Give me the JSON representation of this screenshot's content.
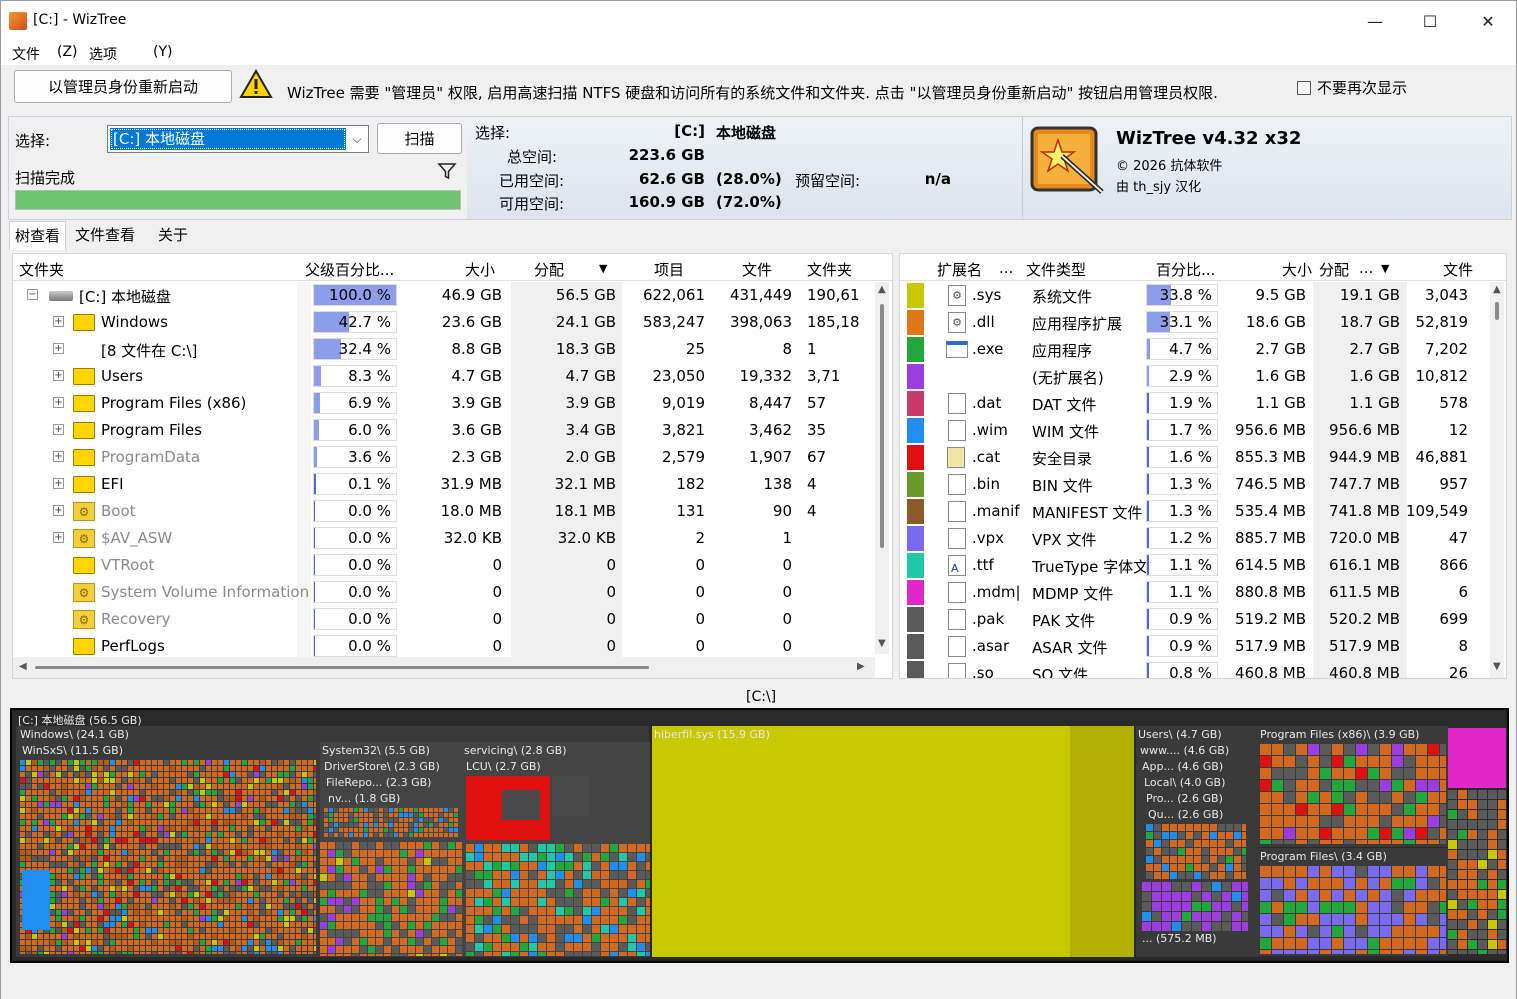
{
  "window": {
    "title": "[C:]  - WizTree",
    "minimize": "—",
    "maximize": "☐",
    "close": "✕"
  },
  "menu": [
    "文件",
    "(Z)",
    "选项",
    "(Y)"
  ],
  "admin": {
    "button": "以管理员身份重新启动",
    "message": "WizTree 需要 \"管理员\" 权限, 启用高速扫描 NTFS 硬盘和访问所有的系统文件和文件夹. 点击 \"以管理员身份重新启动\" 按钮启用管理员权限.",
    "dont_show": "不要再次显示"
  },
  "select": {
    "label": "选择:",
    "value": "[C:] 本地磁盘",
    "scan_button": "扫描",
    "status": "扫描完成",
    "progress": 1.0
  },
  "info": {
    "select_label": "选择:",
    "drive": "[C:]",
    "drive_name": "本地磁盘",
    "total_label": "总空间:",
    "total": "223.6 GB",
    "used_label": "已用空间:",
    "used": "62.6 GB",
    "used_pct": "(28.0%)",
    "free_label": "可用空间:",
    "free": "160.9 GB",
    "free_pct": "(72.0%)",
    "reserved_label": "预留空间:",
    "reserved": "n/a"
  },
  "brand": {
    "name": "WizTree v4.32 x32",
    "copyright": "© 2026 抗体软件",
    "credit": "由 th_sjy 汉化"
  },
  "tabs": [
    "树查看",
    "文件查看",
    "关于"
  ],
  "tree": {
    "columns": [
      "文件夹",
      "父级百分比...",
      "大小",
      "分配",
      "项目",
      "文件",
      "文件夹"
    ],
    "rows": [
      {
        "name": "[C:] 本地磁盘",
        "pct": "100.0 %",
        "pctv": 1.0,
        "size": "46.9 GB",
        "alloc": "56.5 GB",
        "items": "622,061",
        "files": "431,449",
        "folders": "190,61",
        "icon": "drive",
        "exp": "−",
        "gray": false
      },
      {
        "name": "Windows",
        "pct": "42.7 %",
        "pctv": 0.427,
        "size": "23.6 GB",
        "alloc": "24.1 GB",
        "items": "583,247",
        "files": "398,063",
        "folders": "185,18",
        "icon": "folder",
        "exp": "+",
        "gray": false
      },
      {
        "name": "[8 文件在       C:\\]",
        "pct": "32.4 %",
        "pctv": 0.324,
        "size": "8.8 GB",
        "alloc": "18.3 GB",
        "items": "25",
        "files": "8",
        "folders": "1",
        "icon": "none",
        "exp": "+",
        "gray": false
      },
      {
        "name": "Users",
        "pct": "8.3 %",
        "pctv": 0.083,
        "size": "4.7 GB",
        "alloc": "4.7 GB",
        "items": "23,050",
        "files": "19,332",
        "folders": "3,71",
        "icon": "folder",
        "exp": "+",
        "gray": false
      },
      {
        "name": "Program Files (x86)",
        "pct": "6.9 %",
        "pctv": 0.069,
        "size": "3.9 GB",
        "alloc": "3.9 GB",
        "items": "9,019",
        "files": "8,447",
        "folders": "57",
        "icon": "folder",
        "exp": "+",
        "gray": false
      },
      {
        "name": "Program Files",
        "pct": "6.0 %",
        "pctv": 0.06,
        "size": "3.6 GB",
        "alloc": "3.4 GB",
        "items": "3,821",
        "files": "3,462",
        "folders": "35",
        "icon": "folder",
        "exp": "+",
        "gray": false
      },
      {
        "name": "ProgramData",
        "pct": "3.6 %",
        "pctv": 0.036,
        "size": "2.3 GB",
        "alloc": "2.0 GB",
        "items": "2,579",
        "files": "1,907",
        "folders": "67",
        "icon": "folder",
        "exp": "+",
        "gray": true
      },
      {
        "name": "EFI",
        "pct": "0.1 %",
        "pctv": 0.001,
        "size": "31.9 MB",
        "alloc": "32.1 MB",
        "items": "182",
        "files": "138",
        "folders": "4",
        "icon": "folder",
        "exp": "+",
        "gray": false
      },
      {
        "name": "Boot",
        "pct": "0.0 %",
        "pctv": 0,
        "size": "18.0 MB",
        "alloc": "18.1 MB",
        "items": "131",
        "files": "90",
        "folders": "4",
        "icon": "gear",
        "exp": "+",
        "gray": true
      },
      {
        "name": "$AV_ASW",
        "pct": "0.0 %",
        "pctv": 0,
        "size": "32.0 KB",
        "alloc": "32.0 KB",
        "items": "2",
        "files": "1",
        "folders": "",
        "icon": "gear",
        "exp": "+",
        "gray": true
      },
      {
        "name": "VTRoot",
        "pct": "0.0 %",
        "pctv": 0,
        "size": "0",
        "alloc": "0",
        "items": "0",
        "files": "0",
        "folders": "",
        "icon": "folder",
        "exp": "",
        "gray": true
      },
      {
        "name": "System Volume Information",
        "pct": "0.0 %",
        "pctv": 0,
        "size": "0",
        "alloc": "0",
        "items": "0",
        "files": "0",
        "folders": "",
        "icon": "gear",
        "exp": "",
        "gray": true
      },
      {
        "name": "Recovery",
        "pct": "0.0 %",
        "pctv": 0,
        "size": "0",
        "alloc": "0",
        "items": "0",
        "files": "0",
        "folders": "",
        "icon": "gear",
        "exp": "",
        "gray": true
      },
      {
        "name": "PerfLogs",
        "pct": "0.0 %",
        "pctv": 0,
        "size": "0",
        "alloc": "0",
        "items": "0",
        "files": "0",
        "folders": "",
        "icon": "folder",
        "exp": "",
        "gray": false
      }
    ]
  },
  "ext": {
    "columns": [
      "扩展名",
      "...",
      "文件类型",
      "百分比...",
      "大小",
      "分配",
      "...",
      "文件"
    ],
    "rows": [
      {
        "color": "#c8c800",
        "ext": ".sys",
        "type": "系统文件",
        "pct": "33.8 %",
        "pctv": 0.338,
        "size": "9.5 GB",
        "alloc": "19.1 GB",
        "files": "3,043",
        "icon": "gear"
      },
      {
        "color": "#e07818",
        "ext": ".dll",
        "type": "应用程序扩展",
        "pct": "33.1 %",
        "pctv": 0.331,
        "size": "18.6 GB",
        "alloc": "18.7 GB",
        "files": "52,819",
        "icon": "gear"
      },
      {
        "color": "#22a83a",
        "ext": ".exe",
        "type": "应用程序",
        "pct": "4.7 %",
        "pctv": 0.047,
        "size": "2.7 GB",
        "alloc": "2.7 GB",
        "files": "7,202",
        "icon": "exe"
      },
      {
        "color": "#9c3de0",
        "ext": "",
        "type": "(无扩展名)",
        "pct": "2.9 %",
        "pctv": 0.029,
        "size": "1.6 GB",
        "alloc": "1.6 GB",
        "files": "10,812",
        "icon": "none"
      },
      {
        "color": "#c83a6a",
        "ext": ".dat",
        "type": "DAT 文件",
        "pct": "1.9 %",
        "pctv": 0.019,
        "size": "1.1 GB",
        "alloc": "1.1 GB",
        "files": "578",
        "icon": "doc"
      },
      {
        "color": "#1e8ef0",
        "ext": ".wim",
        "type": "WIM 文件",
        "pct": "1.7 %",
        "pctv": 0.017,
        "size": "956.6 MB",
        "alloc": "956.6 MB",
        "files": "12",
        "icon": "doc"
      },
      {
        "color": "#e01010",
        "ext": ".cat",
        "type": "安全目录",
        "pct": "1.6 %",
        "pctv": 0.016,
        "size": "855.3 MB",
        "alloc": "944.9 MB",
        "files": "46,881",
        "icon": "cat"
      },
      {
        "color": "#6a9a2a",
        "ext": ".bin",
        "type": "BIN 文件",
        "pct": "1.3 %",
        "pctv": 0.013,
        "size": "746.5 MB",
        "alloc": "747.7 MB",
        "files": "957",
        "icon": "doc"
      },
      {
        "color": "#8a5a28",
        "ext": ".manif",
        "type": "MANIFEST 文件",
        "pct": "1.3 %",
        "pctv": 0.013,
        "size": "535.4 MB",
        "alloc": "741.8 MB",
        "files": "109,549",
        "icon": "doc"
      },
      {
        "color": "#7a6af0",
        "ext": ".vpx",
        "type": "VPX 文件",
        "pct": "1.2 %",
        "pctv": 0.012,
        "size": "885.7 MB",
        "alloc": "720.0 MB",
        "files": "47",
        "icon": "doc"
      },
      {
        "color": "#20c8a8",
        "ext": ".ttf",
        "type": "TrueType 字体文",
        "pct": "1.1 %",
        "pctv": 0.011,
        "size": "614.5 MB",
        "alloc": "616.1 MB",
        "files": "866",
        "icon": "font"
      },
      {
        "color": "#e028c8",
        "ext": ".mdm|",
        "type": "MDMP 文件",
        "pct": "1.1 %",
        "pctv": 0.011,
        "size": "880.8 MB",
        "alloc": "611.5 MB",
        "files": "6",
        "icon": "doc"
      },
      {
        "color": "#5a5a5a",
        "ext": ".pak",
        "type": "PAK 文件",
        "pct": "0.9 %",
        "pctv": 0.009,
        "size": "519.2 MB",
        "alloc": "520.2 MB",
        "files": "699",
        "icon": "doc"
      },
      {
        "color": "#5a5a5a",
        "ext": ".asar",
        "type": "ASAR 文件",
        "pct": "0.9 %",
        "pctv": 0.009,
        "size": "517.9 MB",
        "alloc": "517.9 MB",
        "files": "8",
        "icon": "doc"
      },
      {
        "color": "#5a5a5a",
        "ext": ".so",
        "type": "SO 文件",
        "pct": "0.8 %",
        "pctv": 0.008,
        "size": "460.8 MB",
        "alloc": "460.8 MB",
        "files": "26",
        "icon": "doc"
      }
    ]
  },
  "path": "[C:\\]",
  "treemap": {
    "root": "[C:] 本地磁盘  (56.5 GB)",
    "labels": {
      "windows": "Windows\\  (24.1 GB)",
      "winsxs": "WinSxS\\  (11.5 GB)",
      "system32": "System32\\  (5.5 GB)",
      "driverstore": "DriverStore\\  (2.3 GB)",
      "filerepo": "FileRepo...  (2.3 GB)",
      "nv": "nv...  (1.8 GB)",
      "servicing": "servicing\\  (2.8 GB)",
      "lcu": "LCU\\  (2.7 GB)",
      "hiberfil": "hiberfil.sys  (15.9 GB)",
      "users": "Users\\  (4.7 GB)",
      "www": "www....  (4.6 GB)",
      "app": "App...  (4.6 GB)",
      "local": "Local\\  (4.0 GB)",
      "pro": "Pro...  (2.6 GB)",
      "qu": "Qu...  (2.6 GB)",
      "small": "...  (575.2 MB)",
      "pfx86": "Program Files (x86)\\  (3.9 GB)",
      "pf": "Program Files\\  (3.4 GB)"
    }
  }
}
